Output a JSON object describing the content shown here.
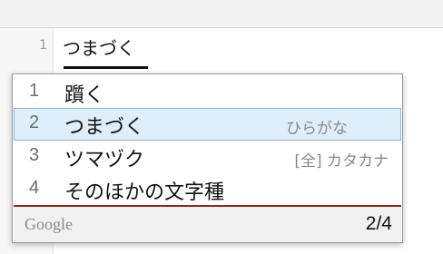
{
  "editor": {
    "line_number": "1",
    "composing_text": "つまづく"
  },
  "candidates": [
    {
      "number": "1",
      "text": "躓く",
      "description": ""
    },
    {
      "number": "2",
      "text": "つまづく",
      "description": "ひらがな"
    },
    {
      "number": "3",
      "text": "ツマヅク",
      "description": "[全] カタカナ"
    },
    {
      "number": "4",
      "text": "そのほかの文字種",
      "description": ""
    }
  ],
  "selected_index": 2,
  "footer": {
    "brand": "Google",
    "page_indicator": "2/4"
  },
  "colors": {
    "selection_background": "#deeefb",
    "selection_border": "#8cb4da",
    "divider": "#8b2a24"
  }
}
